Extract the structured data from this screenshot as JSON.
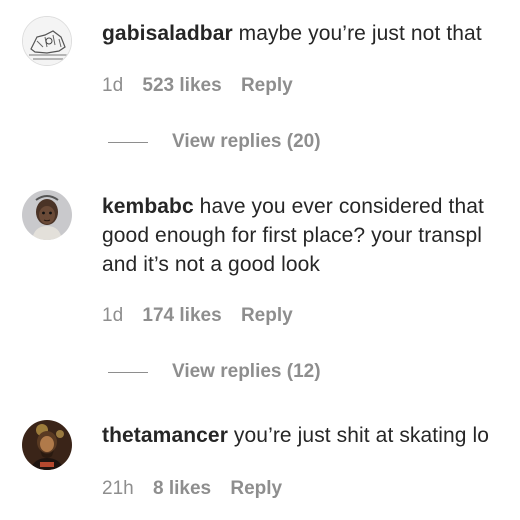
{
  "comments": [
    {
      "username": "gabisaladbar",
      "text": " maybe you’re just not that",
      "time": "1d",
      "likes": "523 likes",
      "reply": "Reply",
      "view_replies": "View replies (20)"
    },
    {
      "username": "kembabc",
      "text": " have you ever considered that",
      "text_line2": "good enough for first place? your transpl",
      "text_line3": "and it’s not a good look",
      "time": "1d",
      "likes": "174 likes",
      "reply": "Reply",
      "view_replies": "View replies (12)"
    },
    {
      "username": "thetamancer",
      "text": " you’re just shit at skating lo",
      "time": "21h",
      "likes": "8 likes",
      "reply": "Reply"
    }
  ],
  "colors": {
    "text": "#262626",
    "muted": "#8e8e8e"
  }
}
